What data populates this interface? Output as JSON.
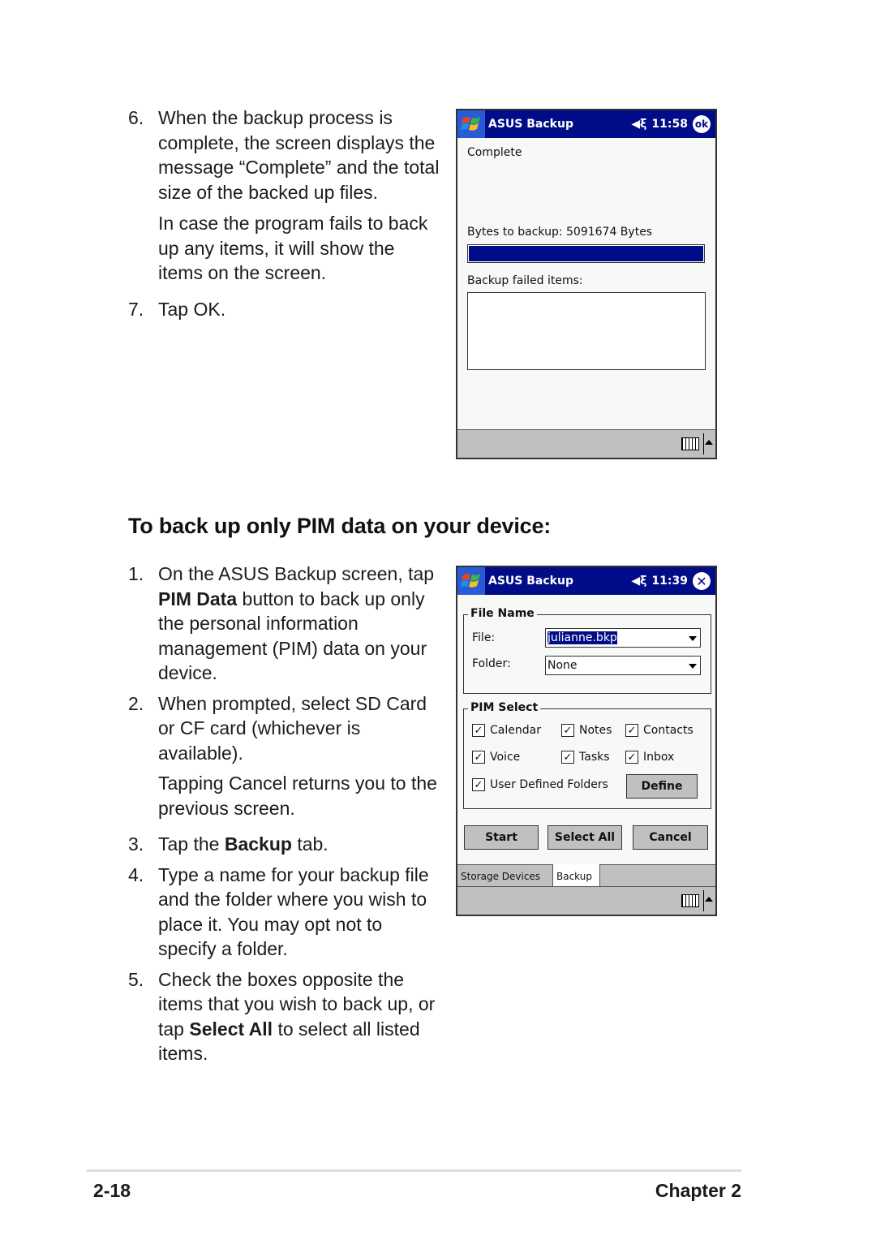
{
  "top_section": {
    "step6": {
      "num": "6.",
      "lines": [
        "When the backup process is",
        "complete, the screen displays the",
        "message “Complete” and the total",
        "size of the backed up files."
      ]
    },
    "step6_note": [
      "In case the program fails to back",
      "up any items, it will show the",
      "items on the screen."
    ],
    "step7": {
      "num": "7.",
      "text": "Tap OK."
    }
  },
  "screen1": {
    "app_title": "ASUS Backup",
    "time": "11:58",
    "ok_label": "ok",
    "status": "Complete",
    "bytes_label": "Bytes to backup: 5091674 Bytes",
    "progress_percent": 100,
    "failed_label": "Backup failed items:",
    "failed_items": []
  },
  "heading": "To back up only PIM data on your device:",
  "bottom_section": {
    "step1": {
      "num": "1.",
      "line1": "On the ASUS Backup screen, tap",
      "bold": "PIM Data",
      "line2_rest": " button to back up only",
      "lines": [
        "the personal information",
        "management (PIM) data on your",
        "device."
      ]
    },
    "step2": {
      "num": "2.",
      "lines": [
        "When prompted, select SD Card",
        "or CF card (whichever is",
        "available)."
      ]
    },
    "step2_note": [
      "Tapping Cancel returns you to the",
      "previous screen."
    ],
    "step3": {
      "num": "3.",
      "pre": "Tap the ",
      "bold": "Backup",
      "post": " tab."
    },
    "step4": {
      "num": "4.",
      "lines": [
        "Type a name for your backup file",
        "and the folder where you wish to",
        "place it. You may opt not to",
        "specify a folder."
      ]
    },
    "step5": {
      "num": "5.",
      "lines": [
        "Check the boxes opposite the",
        "items that you wish to back up, or"
      ],
      "pre": "tap ",
      "bold": "Select All",
      "post": " to select all listed",
      "last": "items."
    }
  },
  "screen2": {
    "app_title": "ASUS Backup",
    "time": "11:39",
    "file_group": "File Name",
    "file_label": "File:",
    "file_value": "julianne.bkp",
    "folder_label": "Folder:",
    "folder_value": "None",
    "pim_group": "PIM Select",
    "checkboxes": [
      {
        "label": "Calendar",
        "checked": true
      },
      {
        "label": "Notes",
        "checked": true
      },
      {
        "label": "Contacts",
        "checked": true
      },
      {
        "label": "Voice",
        "checked": true
      },
      {
        "label": "Tasks",
        "checked": true
      },
      {
        "label": "Inbox",
        "checked": true
      },
      {
        "label": "User Defined Folders",
        "checked": true
      }
    ],
    "define_button": "Define",
    "start_button": "Start",
    "select_all_button": "Select All",
    "cancel_button": "Cancel",
    "tabs": [
      {
        "label": "Storage Devices",
        "active": false
      },
      {
        "label": "Backup",
        "active": true
      }
    ]
  },
  "footer": {
    "page": "2-18",
    "chapter": "Chapter 2"
  },
  "colors": {
    "titlebar": "#000c88",
    "progress": "#000c88",
    "menubar": "#c0c0c0"
  }
}
